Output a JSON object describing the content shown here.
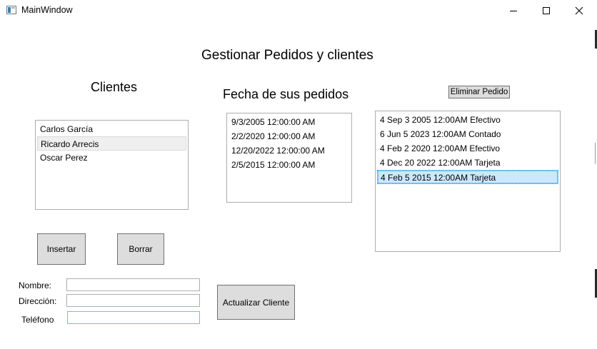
{
  "window": {
    "title": "MainWindow",
    "controls": {
      "minimize": "minimize-icon",
      "maximize": "maximize-icon",
      "close": "close-icon"
    }
  },
  "main": {
    "heading": "Gestionar Pedidos y clientes",
    "clients_heading": "Clientes",
    "orders_heading": "Fecha de sus pedidos",
    "delete_order_label": "Eliminar Pedido"
  },
  "clients": {
    "items": [
      {
        "label": "Carlos García",
        "selected": false
      },
      {
        "label": "Ricardo Arrecis",
        "selected": true
      },
      {
        "label": "Oscar Perez",
        "selected": false
      }
    ]
  },
  "order_dates": {
    "items": [
      "9/3/2005 12:00:00 AM",
      "2/2/2020 12:00:00 AM",
      "12/20/2022 12:00:00 AM",
      "2/5/2015 12:00:00 AM"
    ]
  },
  "orders": {
    "items": [
      {
        "label": "4 Sep  3 2005 12:00AM Efectivo",
        "selected": false
      },
      {
        "label": "6 Jun  5 2023 12:00AM Contado",
        "selected": false
      },
      {
        "label": "4 Feb  2 2020 12:00AM Efectivo",
        "selected": false
      },
      {
        "label": "4 Dec 20 2022 12:00AM Tarjeta",
        "selected": false
      },
      {
        "label": "4 Feb  5 2015 12:00AM Tarjeta",
        "selected": true
      }
    ]
  },
  "actions": {
    "insert_label": "Insertar",
    "delete_label": "Borrar",
    "update_label": "Actualizar Cliente"
  },
  "form": {
    "name_label": "Nombre:",
    "address_label": "Dirección:",
    "phone_label": "Teléfono",
    "name_value": "",
    "address_value": "",
    "phone_value": ""
  },
  "colors": {
    "selected_gray": "#efefef",
    "selected_blue": "#cce8ff",
    "focus_border": "#7eb4ea",
    "button_face": "#dddddd"
  }
}
